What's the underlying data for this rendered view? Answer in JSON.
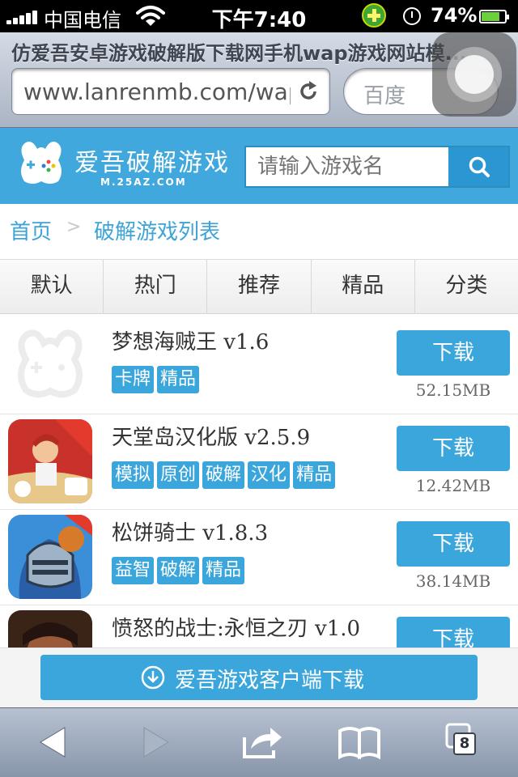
{
  "status_bar": {
    "carrier": "中国电信",
    "time": "下午7:40",
    "battery": "74%",
    "icons": [
      "signal-icon",
      "wifi-icon",
      "plus-app-icon",
      "alarm-clock-icon",
      "battery-icon"
    ]
  },
  "browser": {
    "page_title": "仿爱吾安卓游戏破解版下载网手机wap游戏网站模...",
    "url": "www.lanrenmb.com/wap",
    "search_placeholder": "百度"
  },
  "site": {
    "logo_name": "爱吾破解游戏",
    "logo_url": "M.25AZ.COM",
    "search_placeholder": "请输入游戏名",
    "accent_color": "#40a8dc"
  },
  "breadcrumb": {
    "home": "首页",
    "separator": ">",
    "current": "破解游戏列表"
  },
  "tabs": [
    "默认",
    "热门",
    "推荐",
    "精品",
    "分类"
  ],
  "games": [
    {
      "name": "梦想海贼王 v1.6",
      "tags": [
        "卡牌",
        "精品"
      ],
      "download_label": "下载",
      "size": "52.15MB",
      "icon": "placeholder-logo-icon"
    },
    {
      "name": "天堂岛汉化版 v2.5.9",
      "tags": [
        "模拟",
        "原创",
        "破解",
        "汉化",
        "精品"
      ],
      "download_label": "下载",
      "size": "12.42MB",
      "icon": "paradise-island-icon"
    },
    {
      "name": "松饼骑士 v1.8.3",
      "tags": [
        "益智",
        "破解",
        "精品"
      ],
      "download_label": "下载",
      "size": "38.14MB",
      "icon": "muffin-knight-icon"
    },
    {
      "name": "愤怒的战士:永恒之刃 v1.0",
      "tags": [],
      "download_label": "下载",
      "size": "",
      "icon": "warrior-icon"
    }
  ],
  "client_download": {
    "label": "爱吾游戏客户端下载"
  },
  "toolbar": {
    "tab_count": "8",
    "icons": [
      "back-icon",
      "forward-icon",
      "share-icon",
      "bookmarks-icon",
      "tabs-icon"
    ]
  }
}
